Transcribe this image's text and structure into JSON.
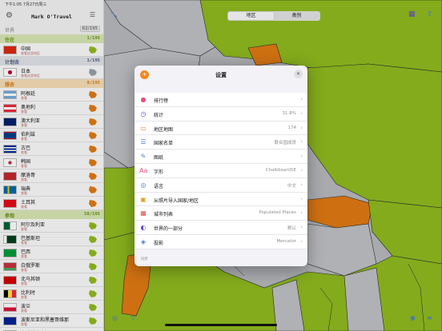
{
  "status_bar": {
    "time": "下午1:05  7月27日周三"
  },
  "sidebar": {
    "title": "Mark O'Travel",
    "world_label": "世界",
    "world_count": "62/195",
    "sections": [
      {
        "key": "live",
        "name": "住在",
        "count": "1/195",
        "rows": [
          {
            "name": "中国",
            "sub": "查看这里地区",
            "flag": "cn"
          }
        ]
      },
      {
        "key": "plan",
        "name": "计划去",
        "count": "1/195",
        "rows": [
          {
            "name": "日本",
            "sub": "查看这里地区",
            "flag": "jp"
          }
        ]
      },
      {
        "key": "visit",
        "name": "想去",
        "count": "9/195",
        "rows": [
          {
            "name": "阿根廷",
            "sub": "查看",
            "flag": "ar"
          },
          {
            "name": "奥地利",
            "sub": "查看",
            "flag": "at"
          },
          {
            "name": "澳大利亚",
            "sub": "查看",
            "flag": "au"
          },
          {
            "name": "伯利兹",
            "sub": "查看",
            "flag": "bz"
          },
          {
            "name": "古巴",
            "sub": "查看",
            "flag": "cu"
          },
          {
            "name": "韩国",
            "sub": "查看",
            "flag": "kr"
          },
          {
            "name": "摩洛哥",
            "sub": "查看",
            "flag": "ma"
          },
          {
            "name": "瑞典",
            "sub": "查看",
            "flag": "se"
          },
          {
            "name": "土耳其",
            "sub": "查看",
            "flag": "tr"
          }
        ]
      },
      {
        "key": "pass",
        "name": "参观",
        "count": "50/195",
        "rows": [
          {
            "name": "阿尔及利亚",
            "sub": "查看",
            "flag": "dz"
          },
          {
            "name": "巴基斯坦",
            "sub": "查看",
            "flag": "pk"
          },
          {
            "name": "巴西",
            "sub": "查看",
            "flag": "br"
          },
          {
            "name": "白俄罗斯",
            "sub": "查看",
            "flag": "by"
          },
          {
            "name": "北马其顿",
            "sub": "查看",
            "flag": "mk"
          },
          {
            "name": "比利时",
            "sub": "查看",
            "flag": "be"
          },
          {
            "name": "波兰",
            "sub": "查看",
            "flag": "pl"
          },
          {
            "name": "波斯尼亚和黑塞哥维那",
            "sub": "查看",
            "flag": "ba"
          },
          {
            "name": "布基纳法索",
            "sub": "查看",
            "flag": "bf"
          }
        ]
      }
    ]
  },
  "toolbar": {
    "tabs": [
      {
        "label": "地区",
        "active": true
      },
      {
        "label": "类别",
        "active": false
      }
    ],
    "expand_icon": "arrows-expand-icon",
    "calendar_icon": "calendar-icon",
    "share_icon": "share-icon"
  },
  "modal": {
    "title": "设置",
    "close_icon": "close-icon",
    "items": [
      {
        "label": "排行榜",
        "value": "",
        "icon": "ranking-icon",
        "glyph": "●",
        "color": "#e8507a"
      },
      {
        "label": "统计",
        "value": "31.8%",
        "icon": "stats-clock-icon",
        "glyph": "◷",
        "color": "#6a46c9"
      },
      {
        "label": "地区地图",
        "value": "174",
        "icon": "map-icon",
        "glyph": "▭",
        "color": "#d97a2b"
      },
      {
        "label": "国家名单",
        "value": "联合国成员",
        "icon": "list-icon",
        "glyph": "☰",
        "color": "#4a7bd0"
      },
      {
        "label": "图纸",
        "value": "",
        "icon": "paintbrush-icon",
        "glyph": "✎",
        "color": "#4a7bd0"
      },
      {
        "label": "字形",
        "value": "ChalkboardSE",
        "icon": "font-icon",
        "glyph": "Aa",
        "color": "#e8507a"
      },
      {
        "label": "语言",
        "value": "中文",
        "icon": "globe-language-icon",
        "glyph": "◎",
        "color": "#4a7bd0"
      },
      {
        "label": "从照片导入国家/地区",
        "value": "",
        "icon": "photo-import-icon",
        "glyph": "▣",
        "color": "#e0a020"
      },
      {
        "label": "城市列表",
        "value": "Populated Places",
        "icon": "city-icon",
        "glyph": "▦",
        "color": "#e05050"
      },
      {
        "label": "世界的一部分",
        "value": "默认",
        "icon": "world-part-icon",
        "glyph": "◐",
        "color": "#6a46c9"
      },
      {
        "label": "投影",
        "value": "Mercator",
        "icon": "projection-layers-icon",
        "glyph": "◈",
        "color": "#4a7bd0"
      }
    ],
    "footer": "同步"
  },
  "colors": {
    "visited": "#8fba1f",
    "want": "#e07a14",
    "unvisited": "#bfc1c4",
    "border": "#2a2a2a"
  }
}
